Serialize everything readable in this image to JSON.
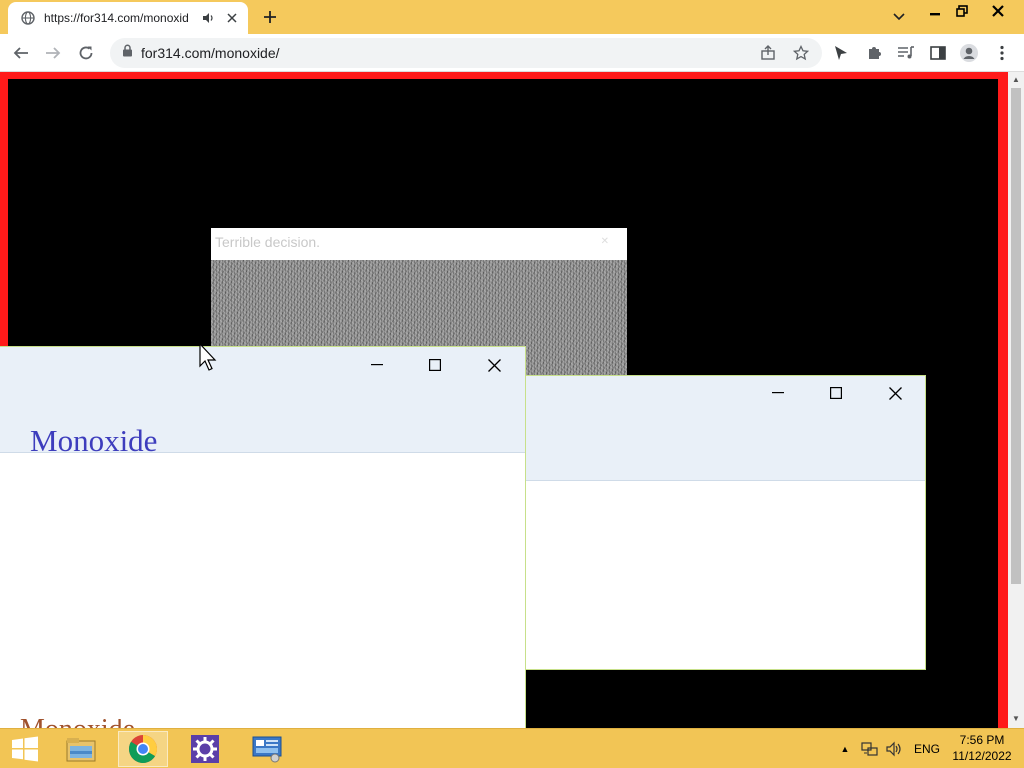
{
  "browser": {
    "tab": {
      "title": "https://for314.com/monoxid",
      "favicon": "globe-icon",
      "audio_icon": "speaker-icon",
      "close_icon": "close-icon"
    },
    "new_tab_icon": "plus-icon",
    "tab_search_icon": "chevron-down-icon",
    "window_controls": [
      "minimize-icon",
      "restore-icon",
      "close-icon"
    ],
    "toolbar": {
      "back_icon": "arrow-left-icon",
      "forward_icon": "arrow-right-icon",
      "reload_icon": "reload-icon",
      "lock_icon": "lock-icon",
      "url": "for314.com/monoxide/",
      "share_icon": "share-icon",
      "bookmark_icon": "star-icon",
      "extension_icons": [
        "send-icon",
        "puzzle-icon",
        "media-icon",
        "side-panel-icon",
        "profile-icon",
        "menu-dots-icon"
      ]
    }
  },
  "page": {
    "border_color": "#ff1a1a",
    "background_color": "#000000",
    "noise_dialog": {
      "title": "Terrible decision."
    },
    "window_main": {
      "app_title": "Monoxide",
      "ghost_text": "Monoxide"
    },
    "window_second": {}
  },
  "taskbar": {
    "color": "#f2c555",
    "items": [
      "windows-start-icon",
      "file-explorer-icon",
      "chrome-icon",
      "settings-icon",
      "control-panel-icon"
    ],
    "tray": {
      "chevron": "▲",
      "network_icon": "network-icon",
      "volume_icon": "volume-icon",
      "language": "ENG"
    },
    "clock": {
      "time": "7:56 PM",
      "date": "11/12/2022"
    }
  }
}
